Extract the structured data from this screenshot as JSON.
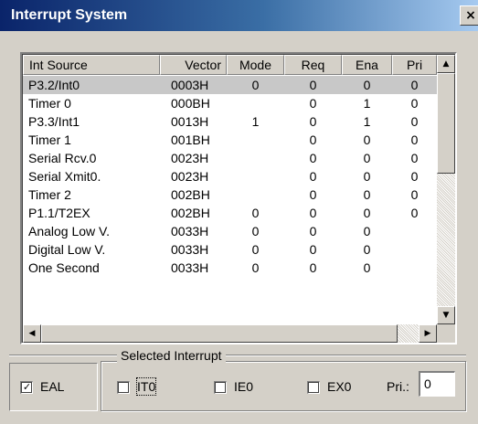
{
  "window": {
    "title": "Interrupt System",
    "close_label": "×"
  },
  "table": {
    "columns": [
      "Int Source",
      "Vector",
      "Mode",
      "Req",
      "Ena",
      "Pri"
    ],
    "selected_row": 0,
    "rows": [
      [
        "P3.2/Int0",
        "0003H",
        "0",
        "0",
        "0",
        "0"
      ],
      [
        "Timer 0",
        "000BH",
        "",
        "0",
        "1",
        "0"
      ],
      [
        "P3.3/Int1",
        "0013H",
        "1",
        "0",
        "1",
        "0"
      ],
      [
        "Timer 1",
        "001BH",
        "",
        "0",
        "0",
        "0"
      ],
      [
        "Serial Rcv.0",
        "0023H",
        "",
        "0",
        "0",
        "0"
      ],
      [
        "Serial Xmit0.",
        "0023H",
        "",
        "0",
        "0",
        "0"
      ],
      [
        "Timer 2",
        "002BH",
        "",
        "0",
        "0",
        "0"
      ],
      [
        "P1.1/T2EX",
        "002BH",
        "0",
        "0",
        "0",
        "0"
      ],
      [
        "Analog Low V.",
        "0033H",
        "0",
        "0",
        "0",
        ""
      ],
      [
        "Digital Low V.",
        "0033H",
        "0",
        "0",
        "0",
        ""
      ],
      [
        "One Second",
        "0033H",
        "0",
        "0",
        "0",
        ""
      ]
    ]
  },
  "scroll": {
    "up": "▲",
    "down": "▼",
    "left": "◀",
    "right": "▶"
  },
  "eal": {
    "label": "EAL",
    "checked": true,
    "check_glyph": "✓"
  },
  "selected_interrupt": {
    "group_label": "Selected Interrupt",
    "it0": {
      "label": "IT0",
      "checked": false
    },
    "ie0": {
      "label": "IE0",
      "checked": false
    },
    "ex0": {
      "label": "EX0",
      "checked": false
    },
    "pri_label": "Pri.:",
    "pri_value": "0"
  }
}
